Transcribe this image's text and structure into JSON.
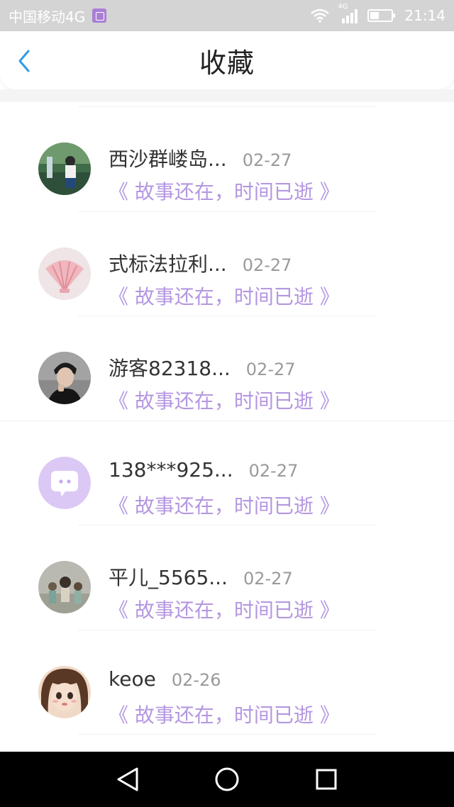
{
  "status_bar": {
    "carrier": "中国移动4G",
    "network": "4G",
    "time": "21:14"
  },
  "header": {
    "title": "收藏",
    "back_icon": "chevron-left-icon",
    "accent": "#2e9bea"
  },
  "favorites": [
    {
      "name": "西沙群嵝岛...",
      "date": "02-27",
      "content": "《 故事还在，时间已逝 》",
      "avatar": "photo-girl"
    },
    {
      "name": "式标法拉利...",
      "date": "02-27",
      "content": "《 故事还在，时间已逝 》",
      "avatar": "seashell"
    },
    {
      "name": "游客82318...",
      "date": "02-27",
      "content": "《 故事还在，时间已逝 》",
      "avatar": "photo-boy"
    },
    {
      "name": "138***925...",
      "date": "02-27",
      "content": "《 故事还在，时间已逝 》",
      "avatar": "default-chat"
    },
    {
      "name": "平儿_5565...",
      "date": "02-27",
      "content": "《 故事还在，时间已逝 》",
      "avatar": "photo-gray"
    },
    {
      "name": "keoe",
      "date": "02-26",
      "content": "《 故事还在，时间已逝 》",
      "avatar": "anime-girl"
    }
  ],
  "colors": {
    "content_text": "#b497e0",
    "default_avatar": "#dcc8f5"
  },
  "android_nav": {
    "back_icon": "triangle-back-icon",
    "home_icon": "circle-home-icon",
    "recents_icon": "square-recents-icon"
  }
}
